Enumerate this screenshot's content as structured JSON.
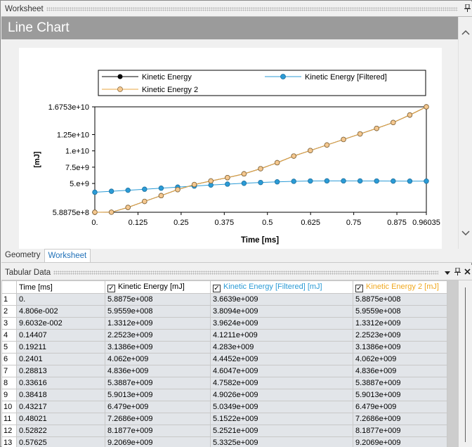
{
  "worksheet_pane": {
    "title": "Worksheet",
    "pin_icon": "pin-icon"
  },
  "chart_title": "Line Chart",
  "tabs": [
    {
      "label": "Geometry"
    },
    {
      "label": "Worksheet"
    }
  ],
  "tabular_pane": {
    "title": "Tabular Data"
  },
  "colors": {
    "series1": "#000000",
    "series2": "#2b9bd6",
    "series3": "#e8a640",
    "series3_fill": "#f5c890",
    "header_gray": "#9b9b9b"
  },
  "chart_data": {
    "type": "line",
    "xlabel": "Time [ms]",
    "ylabel": "[mJ]",
    "xlim": [
      0,
      0.96035
    ],
    "ylim": [
      588750000,
      16753000000
    ],
    "x_ticks": [
      0,
      0.125,
      0.25,
      0.375,
      0.5,
      0.625,
      0.75,
      0.875,
      0.96035
    ],
    "x_tick_labels": [
      "0.",
      "0.125",
      "0.25",
      "0.375",
      "0.5",
      "0.625",
      "0.75",
      "0.875",
      "0.96035"
    ],
    "y_ticks": [
      588750000,
      5000000000,
      7500000000,
      10000000000,
      12500000000,
      16753000000
    ],
    "y_tick_labels": [
      "5.8875e+8",
      "5.e+9",
      "7.5e+9",
      "1.e+10",
      "1.25e+10",
      "1.6753e+10"
    ],
    "legend": [
      {
        "name": "Kinetic Energy"
      },
      {
        "name": "Kinetic Energy [Filtered]"
      },
      {
        "name": "Kinetic Energy 2"
      }
    ],
    "x": [
      0,
      0.04806,
      0.096032,
      0.14407,
      0.19211,
      0.2401,
      0.28813,
      0.33616,
      0.38418,
      0.43217,
      0.48021,
      0.52822,
      0.57625,
      0.62428,
      0.6723,
      0.72032,
      0.76834,
      0.81636,
      0.86438,
      0.9124,
      0.96035
    ],
    "series": [
      {
        "name": "Kinetic Energy",
        "values": [
          588750000,
          595590000,
          1331200000,
          2252300000,
          3138600000,
          4062000000,
          4836000000,
          5388700000,
          5901300000,
          6479000000,
          7268600000,
          8187700000,
          9206900000,
          10050000000,
          10900000000,
          11750000000,
          12600000000,
          13450000000,
          14350000000,
          15500000000,
          16753000000
        ]
      },
      {
        "name": "Kinetic Energy [Filtered]",
        "values": [
          3663900000,
          3809400000,
          3962400000,
          4121100000,
          4283000000,
          4445200000,
          4604700000,
          4758200000,
          4902600000,
          5034900000,
          5152200000,
          5252100000,
          5332500000,
          5380000000,
          5400000000,
          5400000000,
          5390000000,
          5380000000,
          5370000000,
          5360000000,
          5360000000
        ]
      },
      {
        "name": "Kinetic Energy 2",
        "values": [
          588750000,
          595590000,
          1331200000,
          2252300000,
          3138600000,
          4062000000,
          4836000000,
          5388700000,
          5901300000,
          6479000000,
          7268600000,
          8187700000,
          9206900000,
          10050000000,
          10900000000,
          11750000000,
          12600000000,
          13450000000,
          14350000000,
          15500000000,
          16753000000
        ]
      }
    ]
  },
  "table": {
    "columns": [
      {
        "label": ""
      },
      {
        "label": "Time [ms]",
        "checkbox": false
      },
      {
        "label": "Kinetic Energy [mJ]",
        "checkbox": true
      },
      {
        "label": "Kinetic Energy [Filtered] [mJ]",
        "checkbox": true
      },
      {
        "label": "Kinetic Energy 2 [mJ]",
        "checkbox": true
      }
    ],
    "check_mark": "✓",
    "rows": [
      [
        "1",
        "0.",
        "5.8875e+008",
        "3.6639e+009",
        "5.8875e+008"
      ],
      [
        "2",
        "4.806e-002",
        "5.9559e+008",
        "3.8094e+009",
        "5.9559e+008"
      ],
      [
        "3",
        "9.6032e-002",
        "1.3312e+009",
        "3.9624e+009",
        "1.3312e+009"
      ],
      [
        "4",
        "0.14407",
        "2.2523e+009",
        "4.1211e+009",
        "2.2523e+009"
      ],
      [
        "5",
        "0.19211",
        "3.1386e+009",
        "4.283e+009",
        "3.1386e+009"
      ],
      [
        "6",
        "0.2401",
        "4.062e+009",
        "4.4452e+009",
        "4.062e+009"
      ],
      [
        "7",
        "0.28813",
        "4.836e+009",
        "4.6047e+009",
        "4.836e+009"
      ],
      [
        "8",
        "0.33616",
        "5.3887e+009",
        "4.7582e+009",
        "5.3887e+009"
      ],
      [
        "9",
        "0.38418",
        "5.9013e+009",
        "4.9026e+009",
        "5.9013e+009"
      ],
      [
        "10",
        "0.43217",
        "6.479e+009",
        "5.0349e+009",
        "6.479e+009"
      ],
      [
        "11",
        "0.48021",
        "7.2686e+009",
        "5.1522e+009",
        "7.2686e+009"
      ],
      [
        "12",
        "0.52822",
        "8.1877e+009",
        "5.2521e+009",
        "8.1877e+009"
      ],
      [
        "13",
        "0.57625",
        "9.2069e+009",
        "5.3325e+009",
        "9.2069e+009"
      ]
    ]
  }
}
